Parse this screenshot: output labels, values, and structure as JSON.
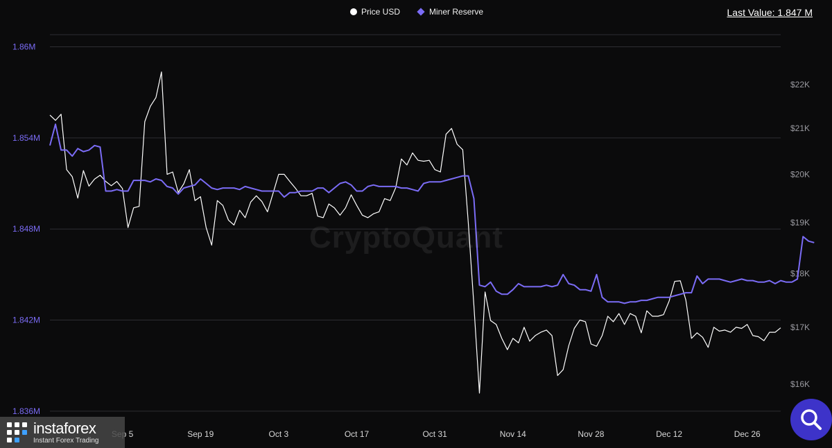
{
  "legend": {
    "price_label": "Price USD",
    "reserve_label": "Miner Reserve"
  },
  "last_value": "Last Value: 1.847 M",
  "watermark": "CryptoQuant",
  "brand": {
    "name": "instaforex",
    "tagline": "Instant Forex Trading"
  },
  "icons": {
    "search": "search-icon",
    "brand_logo": "instaforex-logo-icon"
  },
  "colors": {
    "background": "#0b0b0c",
    "price_line": "#ffffff",
    "reserve_line": "#7b6cf6",
    "grid": "#2e2e33",
    "left_axis_text": "#7b6cf6",
    "right_axis_text": "#9a9aa0",
    "search_button": "#3d33c9"
  },
  "chart_data": {
    "type": "line",
    "x_ticks": [
      "Sep 5",
      "Sep 19",
      "Oct 3",
      "Oct 17",
      "Oct 31",
      "Nov 14",
      "Nov 28",
      "Dec 12",
      "Dec 26"
    ],
    "x_tick_days": [
      0,
      14,
      28,
      42,
      56,
      70,
      84,
      98,
      112
    ],
    "x_range_days": [
      -13,
      118
    ],
    "y_left": {
      "label": "Miner Reserve",
      "ticks": [
        1.836,
        1.842,
        1.848,
        1.854,
        1.86
      ],
      "tick_labels": [
        "1.836M",
        "1.842M",
        "1.848M",
        "1.854M",
        "1.86M"
      ],
      "range": [
        1.8354,
        1.8608
      ]
    },
    "y_right": {
      "label": "Price USD",
      "ticks": [
        16000,
        17000,
        18000,
        19000,
        20000,
        21000,
        22000
      ],
      "tick_labels": [
        "$16K",
        "$17K",
        "$18K",
        "$19K",
        "$20K",
        "$21K",
        "$22K"
      ],
      "scale": "log",
      "range": [
        15400,
        23200
      ]
    },
    "grid": true,
    "series": [
      {
        "name": "Price USD",
        "axis": "right",
        "points": [
          [
            -13,
            21300
          ],
          [
            -12,
            21180
          ],
          [
            -11,
            21320
          ],
          [
            -10,
            20100
          ],
          [
            -9,
            19950
          ],
          [
            -8,
            19500
          ],
          [
            -7,
            20080
          ],
          [
            -6,
            19750
          ],
          [
            -5,
            19900
          ],
          [
            -4,
            19980
          ],
          [
            -3,
            19850
          ],
          [
            -2,
            19760
          ],
          [
            -1,
            19850
          ],
          [
            0,
            19700
          ],
          [
            1,
            18900
          ],
          [
            2,
            19300
          ],
          [
            3,
            19330
          ],
          [
            4,
            21150
          ],
          [
            5,
            21500
          ],
          [
            6,
            21700
          ],
          [
            7,
            22300
          ],
          [
            8,
            20000
          ],
          [
            9,
            20050
          ],
          [
            10,
            19620
          ],
          [
            11,
            19800
          ],
          [
            12,
            20100
          ],
          [
            13,
            19450
          ],
          [
            14,
            19530
          ],
          [
            15,
            18900
          ],
          [
            16,
            18550
          ],
          [
            17,
            19450
          ],
          [
            18,
            19350
          ],
          [
            19,
            19050
          ],
          [
            20,
            18950
          ],
          [
            21,
            19250
          ],
          [
            22,
            19100
          ],
          [
            23,
            19420
          ],
          [
            24,
            19550
          ],
          [
            25,
            19430
          ],
          [
            26,
            19220
          ],
          [
            27,
            19600
          ],
          [
            28,
            20000
          ],
          [
            29,
            20000
          ],
          [
            30,
            19850
          ],
          [
            31,
            19710
          ],
          [
            32,
            19550
          ],
          [
            33,
            19550
          ],
          [
            34,
            19600
          ],
          [
            35,
            19130
          ],
          [
            36,
            19100
          ],
          [
            37,
            19380
          ],
          [
            38,
            19300
          ],
          [
            39,
            19150
          ],
          [
            40,
            19300
          ],
          [
            41,
            19570
          ],
          [
            42,
            19350
          ],
          [
            43,
            19150
          ],
          [
            44,
            19100
          ],
          [
            45,
            19180
          ],
          [
            46,
            19220
          ],
          [
            47,
            19490
          ],
          [
            48,
            19450
          ],
          [
            49,
            19720
          ],
          [
            50,
            20330
          ],
          [
            51,
            20200
          ],
          [
            52,
            20460
          ],
          [
            53,
            20300
          ],
          [
            54,
            20280
          ],
          [
            55,
            20300
          ],
          [
            56,
            20100
          ],
          [
            57,
            20050
          ],
          [
            58,
            20870
          ],
          [
            59,
            21000
          ],
          [
            60,
            20650
          ],
          [
            61,
            20530
          ],
          [
            62,
            19000
          ],
          [
            63,
            17400
          ],
          [
            64,
            15850
          ],
          [
            65,
            17650
          ],
          [
            66,
            17120
          ],
          [
            67,
            17050
          ],
          [
            68,
            16800
          ],
          [
            69,
            16600
          ],
          [
            70,
            16800
          ],
          [
            71,
            16720
          ],
          [
            72,
            17000
          ],
          [
            73,
            16750
          ],
          [
            74,
            16850
          ],
          [
            75,
            16910
          ],
          [
            76,
            16950
          ],
          [
            77,
            16850
          ],
          [
            78,
            16150
          ],
          [
            79,
            16250
          ],
          [
            80,
            16670
          ],
          [
            81,
            16980
          ],
          [
            82,
            17130
          ],
          [
            83,
            17100
          ],
          [
            84,
            16700
          ],
          [
            85,
            16660
          ],
          [
            86,
            16850
          ],
          [
            87,
            17200
          ],
          [
            88,
            17100
          ],
          [
            89,
            17250
          ],
          [
            90,
            17050
          ],
          [
            91,
            17250
          ],
          [
            92,
            17200
          ],
          [
            93,
            16900
          ],
          [
            94,
            17300
          ],
          [
            95,
            17200
          ],
          [
            96,
            17200
          ],
          [
            97,
            17230
          ],
          [
            98,
            17480
          ],
          [
            99,
            17850
          ],
          [
            100,
            17860
          ],
          [
            101,
            17500
          ],
          [
            102,
            16800
          ],
          [
            103,
            16900
          ],
          [
            104,
            16820
          ],
          [
            105,
            16640
          ],
          [
            106,
            17000
          ],
          [
            107,
            16930
          ],
          [
            108,
            16950
          ],
          [
            109,
            16910
          ],
          [
            110,
            17000
          ],
          [
            111,
            16980
          ],
          [
            112,
            17050
          ],
          [
            113,
            16850
          ],
          [
            114,
            16830
          ],
          [
            115,
            16760
          ],
          [
            116,
            16910
          ],
          [
            117,
            16910
          ],
          [
            118,
            16990
          ]
        ]
      },
      {
        "name": "Miner Reserve",
        "axis": "left",
        "points": [
          [
            -13,
            1.8535
          ],
          [
            -12,
            1.8549
          ],
          [
            -11,
            1.8532
          ],
          [
            -10,
            1.8532
          ],
          [
            -9,
            1.8528
          ],
          [
            -8,
            1.8533
          ],
          [
            -7,
            1.8531
          ],
          [
            -6,
            1.8532
          ],
          [
            -5,
            1.8535
          ],
          [
            -4,
            1.8534
          ],
          [
            -3,
            1.8505
          ],
          [
            -2,
            1.8505
          ],
          [
            -1,
            1.8506
          ],
          [
            0,
            1.8505
          ],
          [
            1,
            1.8505
          ],
          [
            2,
            1.8512
          ],
          [
            3,
            1.8512
          ],
          [
            4,
            1.8512
          ],
          [
            5,
            1.8511
          ],
          [
            6,
            1.8513
          ],
          [
            7,
            1.8512
          ],
          [
            8,
            1.8508
          ],
          [
            9,
            1.8507
          ],
          [
            10,
            1.8503
          ],
          [
            11,
            1.8507
          ],
          [
            12,
            1.8508
          ],
          [
            13,
            1.8509
          ],
          [
            14,
            1.8513
          ],
          [
            15,
            1.851
          ],
          [
            16,
            1.8507
          ],
          [
            17,
            1.8506
          ],
          [
            18,
            1.8507
          ],
          [
            19,
            1.8507
          ],
          [
            20,
            1.8507
          ],
          [
            21,
            1.8506
          ],
          [
            22,
            1.8508
          ],
          [
            23,
            1.8507
          ],
          [
            24,
            1.8506
          ],
          [
            25,
            1.8505
          ],
          [
            26,
            1.8505
          ],
          [
            27,
            1.8505
          ],
          [
            28,
            1.8505
          ],
          [
            29,
            1.8501
          ],
          [
            30,
            1.8504
          ],
          [
            31,
            1.8504
          ],
          [
            32,
            1.8505
          ],
          [
            33,
            1.8505
          ],
          [
            34,
            1.8505
          ],
          [
            35,
            1.8507
          ],
          [
            36,
            1.8507
          ],
          [
            37,
            1.8504
          ],
          [
            38,
            1.8507
          ],
          [
            39,
            1.851
          ],
          [
            40,
            1.8511
          ],
          [
            41,
            1.8509
          ],
          [
            42,
            1.8505
          ],
          [
            43,
            1.8505
          ],
          [
            44,
            1.8508
          ],
          [
            45,
            1.8509
          ],
          [
            46,
            1.8508
          ],
          [
            47,
            1.8508
          ],
          [
            48,
            1.8508
          ],
          [
            49,
            1.8508
          ],
          [
            50,
            1.8507
          ],
          [
            51,
            1.8507
          ],
          [
            52,
            1.8506
          ],
          [
            53,
            1.8505
          ],
          [
            54,
            1.851
          ],
          [
            55,
            1.8511
          ],
          [
            56,
            1.8511
          ],
          [
            57,
            1.8511
          ],
          [
            58,
            1.8512
          ],
          [
            59,
            1.8513
          ],
          [
            60,
            1.8514
          ],
          [
            61,
            1.8515
          ],
          [
            62,
            1.8515
          ],
          [
            63,
            1.85
          ],
          [
            64,
            1.8443
          ],
          [
            65,
            1.8442
          ],
          [
            66,
            1.8445
          ],
          [
            67,
            1.8439
          ],
          [
            68,
            1.8437
          ],
          [
            69,
            1.8437
          ],
          [
            70,
            1.844
          ],
          [
            71,
            1.8444
          ],
          [
            72,
            1.8442
          ],
          [
            73,
            1.8442
          ],
          [
            74,
            1.8442
          ],
          [
            75,
            1.8442
          ],
          [
            76,
            1.8443
          ],
          [
            77,
            1.8442
          ],
          [
            78,
            1.8443
          ],
          [
            79,
            1.845
          ],
          [
            80,
            1.8444
          ],
          [
            81,
            1.8443
          ],
          [
            82,
            1.844
          ],
          [
            83,
            1.844
          ],
          [
            84,
            1.8439
          ],
          [
            85,
            1.845
          ],
          [
            86,
            1.8435
          ],
          [
            87,
            1.8432
          ],
          [
            88,
            1.8432
          ],
          [
            89,
            1.8432
          ],
          [
            90,
            1.8431
          ],
          [
            91,
            1.8432
          ],
          [
            92,
            1.8432
          ],
          [
            93,
            1.8433
          ],
          [
            94,
            1.8433
          ],
          [
            95,
            1.8434
          ],
          [
            96,
            1.8435
          ],
          [
            97,
            1.8435
          ],
          [
            98,
            1.8435
          ],
          [
            99,
            1.8436
          ],
          [
            100,
            1.8437
          ],
          [
            101,
            1.8438
          ],
          [
            102,
            1.8438
          ],
          [
            103,
            1.8449
          ],
          [
            104,
            1.8444
          ],
          [
            105,
            1.8447
          ],
          [
            106,
            1.8447
          ],
          [
            107,
            1.8447
          ],
          [
            108,
            1.8446
          ],
          [
            109,
            1.8445
          ],
          [
            110,
            1.8446
          ],
          [
            111,
            1.8447
          ],
          [
            112,
            1.8446
          ],
          [
            113,
            1.8446
          ],
          [
            114,
            1.8445
          ],
          [
            115,
            1.8445
          ],
          [
            116,
            1.8446
          ],
          [
            117,
            1.8444
          ],
          [
            118,
            1.8446
          ],
          [
            119,
            1.8445
          ],
          [
            120,
            1.8445
          ],
          [
            121,
            1.8447
          ],
          [
            122,
            1.8475
          ],
          [
            123,
            1.8472
          ],
          [
            124,
            1.8471
          ]
        ]
      }
    ]
  }
}
